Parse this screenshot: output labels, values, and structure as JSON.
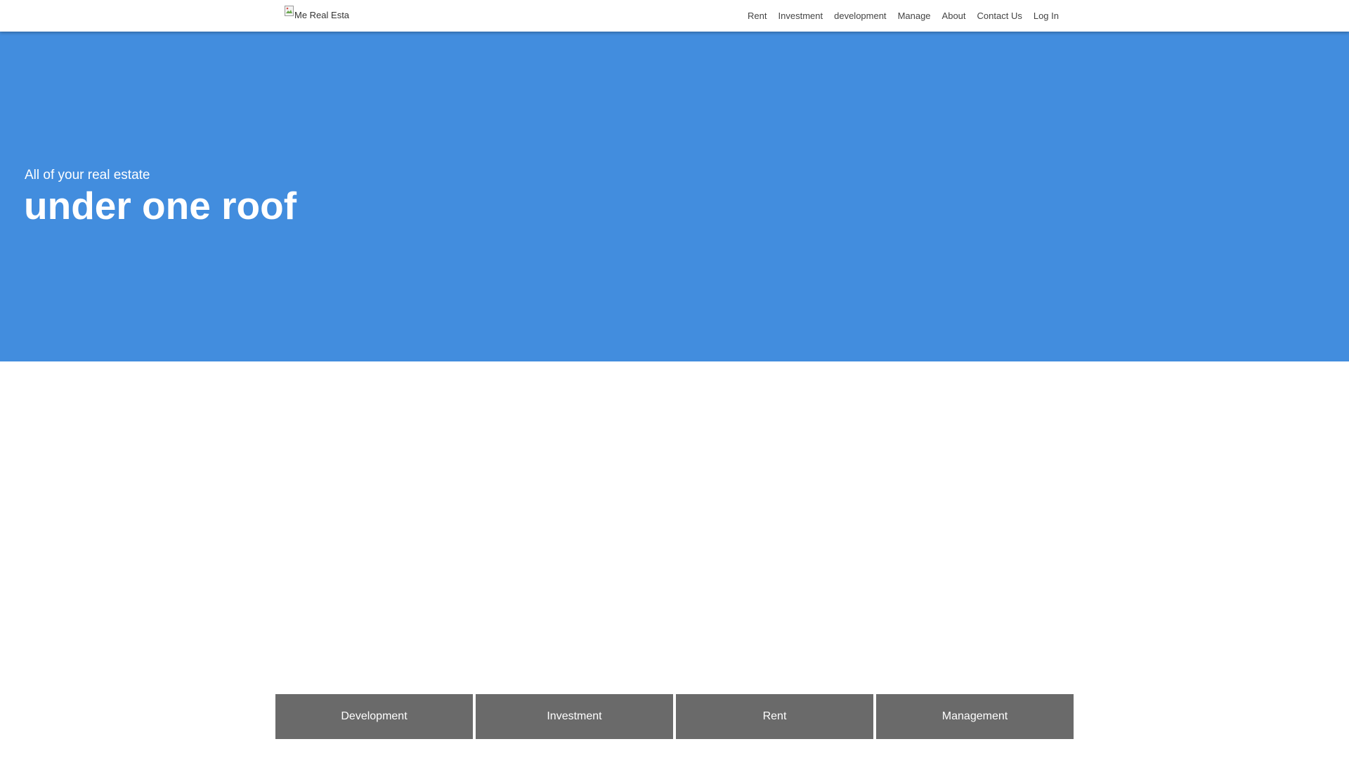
{
  "header": {
    "logo_alt": "Me Real Esta",
    "nav": [
      {
        "label": "Rent"
      },
      {
        "label": "Investment"
      },
      {
        "label": "development"
      },
      {
        "label": "Manage"
      },
      {
        "label": "About"
      },
      {
        "label": "Contact Us"
      },
      {
        "label": "Log In"
      }
    ]
  },
  "hero": {
    "subtitle": "All of your real estate",
    "title": "under one roof",
    "background_color": "#428dde"
  },
  "services": [
    {
      "label": "Development"
    },
    {
      "label": "Investment"
    },
    {
      "label": "Rent"
    },
    {
      "label": "Management"
    }
  ],
  "icons": {
    "logo": "broken-image-icon"
  }
}
